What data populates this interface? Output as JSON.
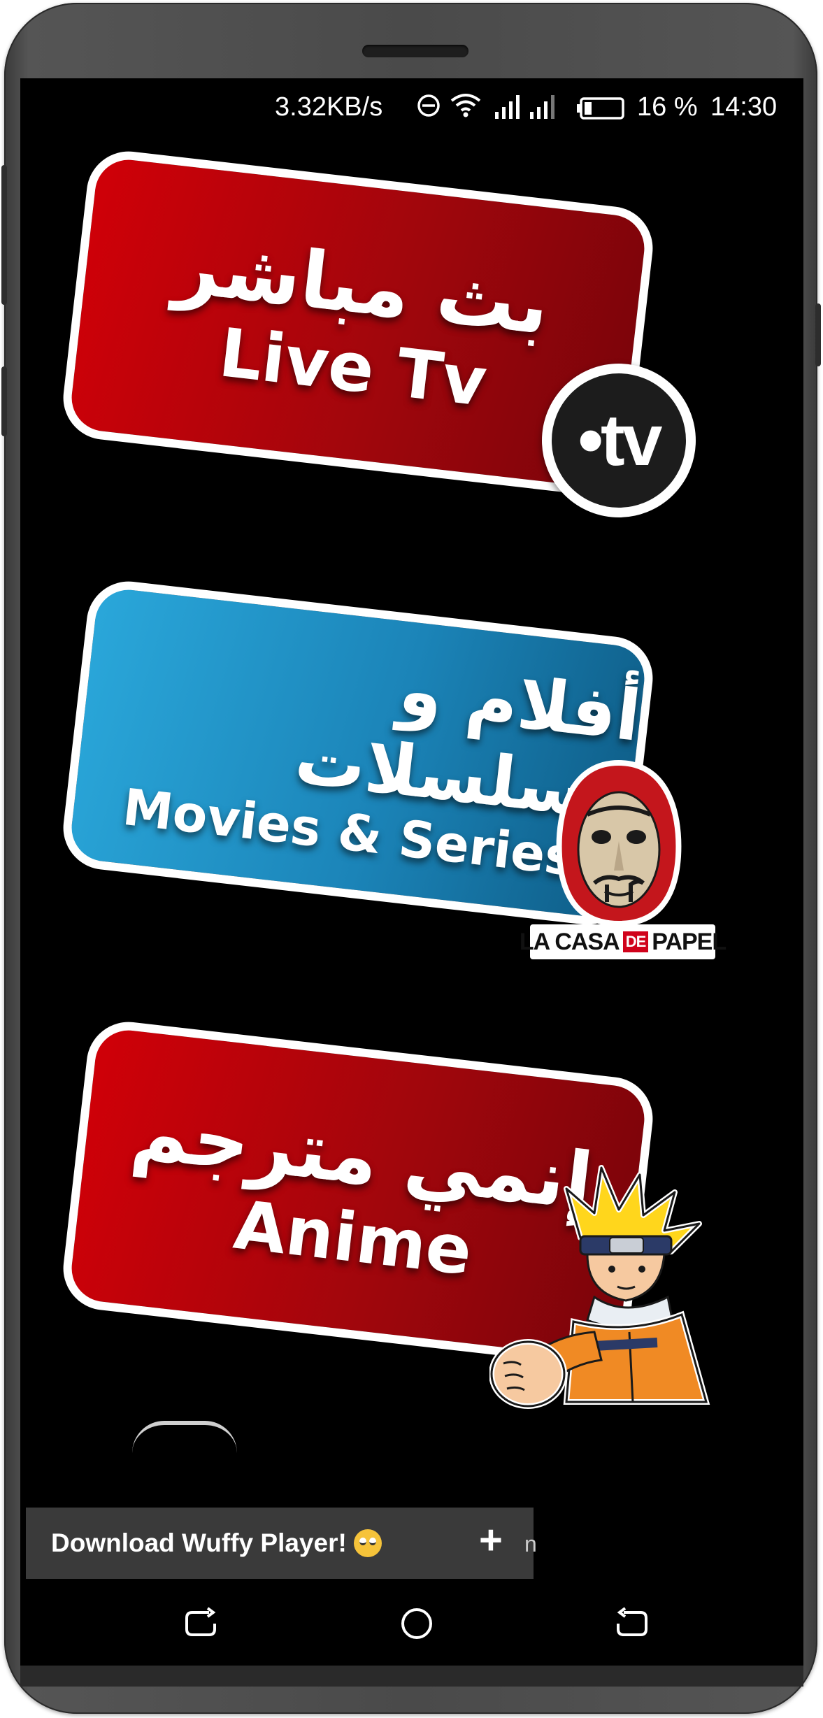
{
  "status_bar": {
    "network_speed": "3.32KB/s",
    "battery_percent": "16 %",
    "time": "14:30",
    "icons": [
      "do-not-disturb-icon",
      "wifi-icon",
      "signal-icon",
      "signal-icon",
      "battery-icon"
    ]
  },
  "menu": {
    "live_tv": {
      "arabic": "بث مباشر",
      "english": "Live Tv",
      "badge": "•tv"
    },
    "movies_series": {
      "arabic": "أفلام و مسلسلات",
      "english": "Movies & Series",
      "badge_label_left": "LA CASA",
      "badge_label_mid": "DE",
      "badge_label_right": "PAPEL"
    },
    "anime": {
      "arabic": "إنمي مترجم",
      "english": "Anime"
    }
  },
  "ad_banner": {
    "text": "Download Wuffy Player!",
    "close_symbol": "+",
    "trailing_char": "n"
  },
  "colors": {
    "card_red": "#c00008",
    "card_blue": "#1b84b8",
    "card_border": "#ffffff",
    "screen_bg": "#000000",
    "ad_bg": "#3a3a3a"
  },
  "navigation": [
    "back-icon",
    "home-icon",
    "recents-icon"
  ]
}
